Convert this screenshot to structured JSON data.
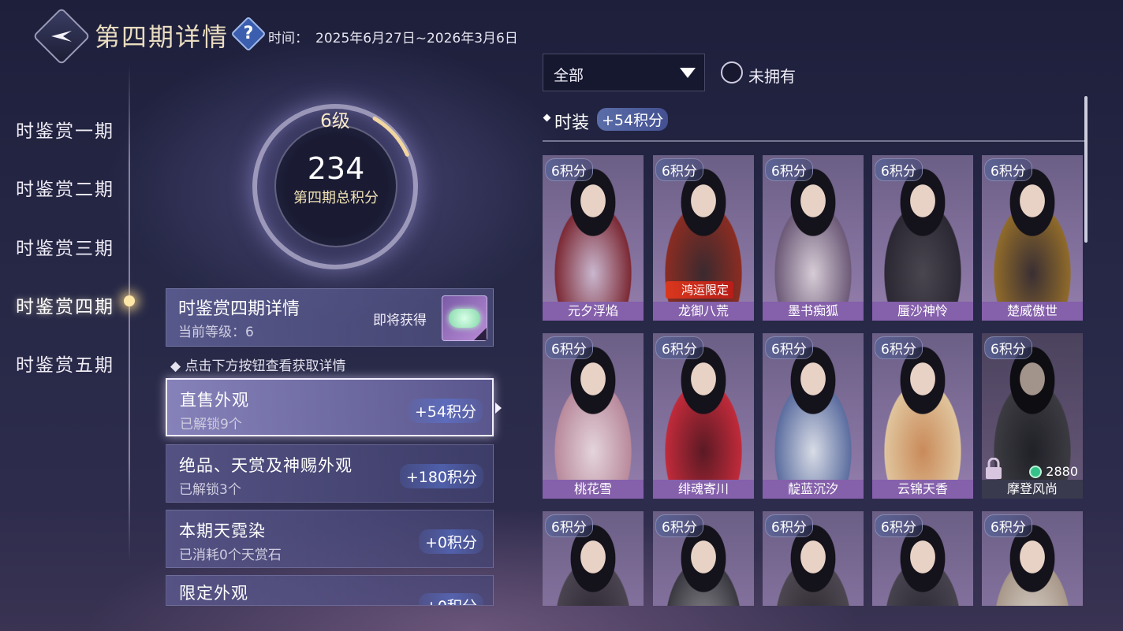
{
  "header": {
    "title": "第四期详情",
    "help_icon": "?",
    "time_label": "时间：",
    "time_value": "2025年6月27日~2026年3月6日"
  },
  "sidebar": {
    "items": [
      {
        "label": "时鉴赏一期"
      },
      {
        "label": "时鉴赏二期"
      },
      {
        "label": "时鉴赏三期"
      },
      {
        "label": "时鉴赏四期",
        "active": true
      },
      {
        "label": "时鉴赏五期"
      }
    ]
  },
  "level": {
    "level_text": "6级",
    "points": "234",
    "points_label": "第四期总积分",
    "progress": 0.1
  },
  "detail": {
    "title": "时鉴赏四期详情",
    "current_level": "当前等级：6",
    "soon_label": "即将获得"
  },
  "hint": "点击下方按钮查看获取详情",
  "sources": [
    {
      "title": "直售外观",
      "sub": "已解锁9个",
      "points": "+54积分",
      "active": true
    },
    {
      "title": "绝品、天赏及神赐外观",
      "sub": "已解锁3个",
      "points": "+180积分"
    },
    {
      "title": "本期天霓染",
      "sub": "已消耗0个天赏石",
      "points": "+0积分"
    },
    {
      "title": "限定外观",
      "sub": "",
      "points": "+0积分"
    }
  ],
  "filter": {
    "selected": "全部",
    "not_owned_label": "未拥有"
  },
  "section": {
    "title": "时装",
    "points": "+54积分"
  },
  "costumes": [
    {
      "pts": "6积分",
      "name": "元夕浮焰"
    },
    {
      "pts": "6积分",
      "name": "龙御八荒",
      "tag": "鸿运限定"
    },
    {
      "pts": "6积分",
      "name": "墨书痴狐"
    },
    {
      "pts": "6积分",
      "name": "蜃沙神怜"
    },
    {
      "pts": "6积分",
      "name": "楚威傲世"
    },
    {
      "pts": "6积分",
      "name": "桃花雪"
    },
    {
      "pts": "6积分",
      "name": "绯魂寄川"
    },
    {
      "pts": "6积分",
      "name": "靛蓝沉汐"
    },
    {
      "pts": "6积分",
      "name": "云锦天香"
    },
    {
      "pts": "6积分",
      "name": "摩登风尚",
      "locked": true,
      "price": "2880"
    },
    {
      "pts": "6积分",
      "name": ""
    },
    {
      "pts": "6积分",
      "name": ""
    },
    {
      "pts": "6积分",
      "name": ""
    },
    {
      "pts": "6积分",
      "name": ""
    },
    {
      "pts": "6积分",
      "name": ""
    }
  ],
  "colors": {
    "card_name_bg": "#8560ab",
    "accent_gold": "#f1e2b4",
    "limited_red": "#d9381e"
  }
}
